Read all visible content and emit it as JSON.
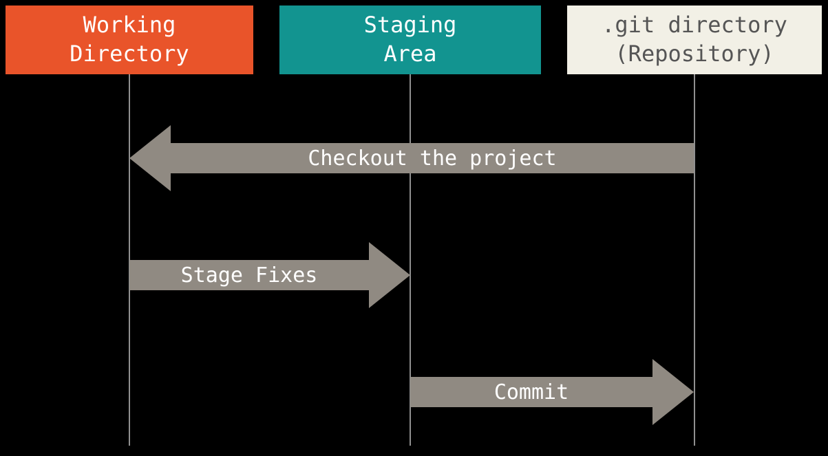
{
  "columns": {
    "working": {
      "line1": "Working",
      "line2": "Directory",
      "color": "#e9542a"
    },
    "staging": {
      "line1": "Staging",
      "line2": "Area",
      "color": "#129490"
    },
    "repo": {
      "line1": ".git directory",
      "line2": "(Repository)",
      "color": "#f2f0e6"
    }
  },
  "arrows": {
    "checkout": {
      "label": "Checkout the project",
      "from": "repo",
      "to": "working",
      "direction": "left"
    },
    "stage": {
      "label": "Stage Fixes",
      "from": "working",
      "to": "staging",
      "direction": "right"
    },
    "commit": {
      "label": "Commit",
      "from": "staging",
      "to": "repo",
      "direction": "right"
    }
  },
  "colors": {
    "arrow": "#908a82",
    "lifeline": "#909090",
    "background": "#000000"
  }
}
